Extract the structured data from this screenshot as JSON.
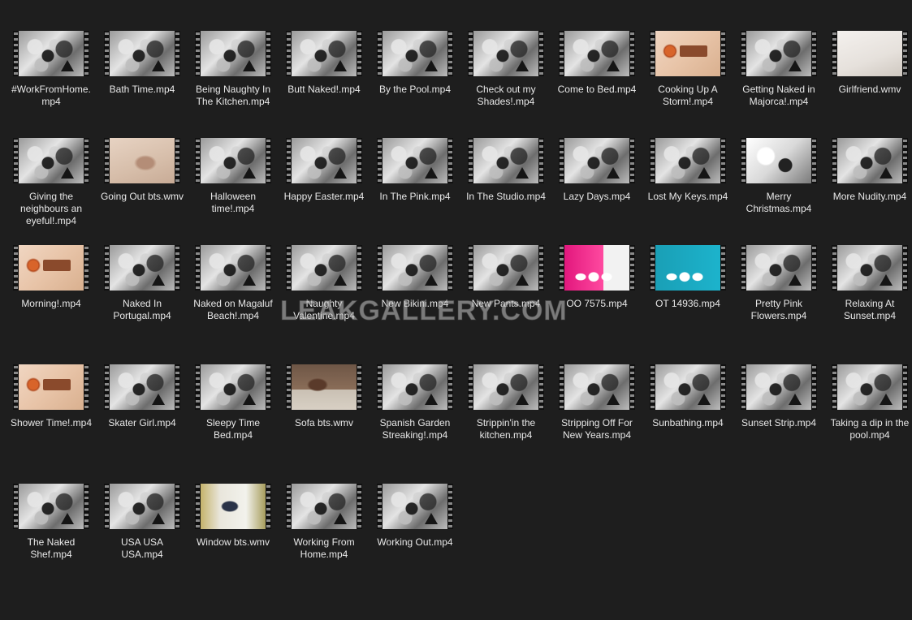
{
  "watermark": "LEAKGALLERY.COM",
  "files": [
    {
      "name": "#WorkFromHome.mp4",
      "thumb": "film"
    },
    {
      "name": "Bath Time.mp4",
      "thumb": "film"
    },
    {
      "name": "Being Naughty In The Kitchen.mp4",
      "thumb": "film"
    },
    {
      "name": "Butt Naked!.mp4",
      "thumb": "film"
    },
    {
      "name": "By the Pool.mp4",
      "thumb": "film"
    },
    {
      "name": "Check out my Shades!.mp4",
      "thumb": "film"
    },
    {
      "name": "Come to Bed.mp4",
      "thumb": "film"
    },
    {
      "name": "Cooking Up A Storm!.mp4",
      "thumb": "brand"
    },
    {
      "name": "Getting Naked in Majorca!.mp4",
      "thumb": "film"
    },
    {
      "name": "Girlfriend.wmv",
      "thumb": "photo-light"
    },
    {
      "name": "Giving the neighbours an eyeful!.mp4",
      "thumb": "film"
    },
    {
      "name": "Going Out bts.wmv",
      "thumb": "photo-beige"
    },
    {
      "name": "Halloween time!.mp4",
      "thumb": "film"
    },
    {
      "name": "Happy Easter.mp4",
      "thumb": "film"
    },
    {
      "name": "In The Pink.mp4",
      "thumb": "film"
    },
    {
      "name": "In The Studio.mp4",
      "thumb": "film"
    },
    {
      "name": "Lazy Days.mp4",
      "thumb": "film"
    },
    {
      "name": "Lost My Keys.mp4",
      "thumb": "film"
    },
    {
      "name": "Merry Christmas.mp4",
      "thumb": "photo-bw"
    },
    {
      "name": "More Nudity.mp4",
      "thumb": "film"
    },
    {
      "name": "Morning!.mp4",
      "thumb": "brand"
    },
    {
      "name": "Naked In Portugal.mp4",
      "thumb": "film"
    },
    {
      "name": "Naked on Magaluf Beach!.mp4",
      "thumb": "film"
    },
    {
      "name": "Naughty Valentine.mp4",
      "thumb": "film"
    },
    {
      "name": "New Bikini.mp4",
      "thumb": "film"
    },
    {
      "name": "New Pants.mp4",
      "thumb": "film"
    },
    {
      "name": "OO 7575.mp4",
      "thumb": "photo-pink"
    },
    {
      "name": "OT 14936.mp4",
      "thumb": "photo-teal"
    },
    {
      "name": "Pretty Pink Flowers.mp4",
      "thumb": "film"
    },
    {
      "name": "Relaxing At Sunset.mp4",
      "thumb": "film"
    },
    {
      "name": "Shower Time!.mp4",
      "thumb": "brand"
    },
    {
      "name": "Skater Girl.mp4",
      "thumb": "film"
    },
    {
      "name": "Sleepy Time Bed.mp4",
      "thumb": "film"
    },
    {
      "name": "Sofa bts.wmv",
      "thumb": "photo-room"
    },
    {
      "name": "Spanish Garden Streaking!.mp4",
      "thumb": "film"
    },
    {
      "name": "Strippin'in the kitchen.mp4",
      "thumb": "film"
    },
    {
      "name": "Stripping Off For New Years.mp4",
      "thumb": "film"
    },
    {
      "name": "Sunbathing.mp4",
      "thumb": "film"
    },
    {
      "name": "Sunset Strip.mp4",
      "thumb": "film"
    },
    {
      "name": "Taking a dip in the pool.mp4",
      "thumb": "film"
    },
    {
      "name": "The Naked Shef.mp4",
      "thumb": "film"
    },
    {
      "name": "USA USA USA.mp4",
      "thumb": "film"
    },
    {
      "name": "Window bts.wmv",
      "thumb": "photo-window"
    },
    {
      "name": "Working From Home.mp4",
      "thumb": "film"
    },
    {
      "name": "Working Out.mp4",
      "thumb": "film"
    }
  ]
}
